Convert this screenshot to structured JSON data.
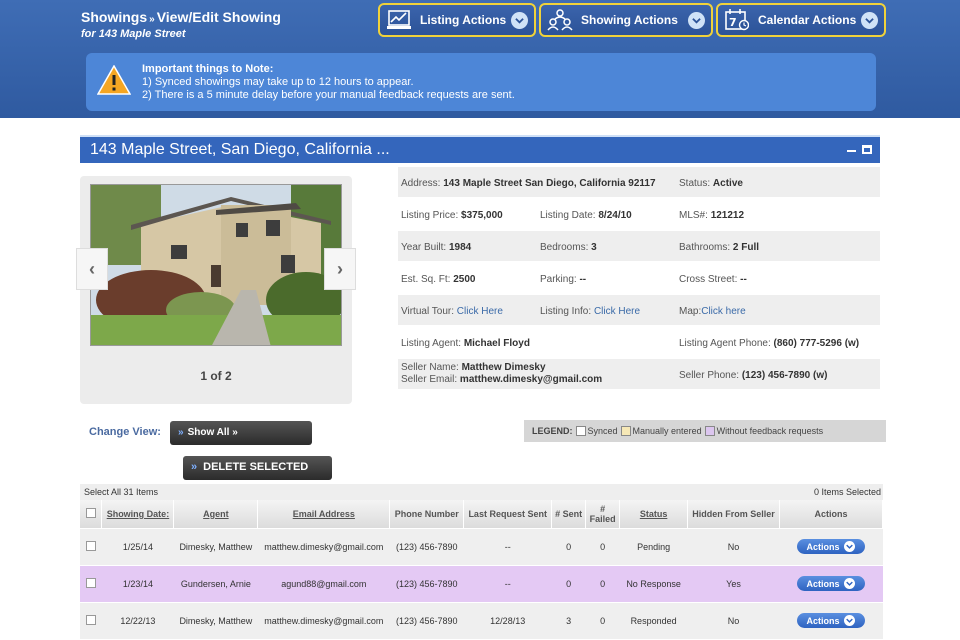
{
  "header": {
    "breadcrumb_root": "Showings",
    "breadcrumb_sep": "»",
    "breadcrumb_current": "View/Edit Showing",
    "subtitle": "for 143 Maple Street",
    "buttons": [
      {
        "label": "Listing Actions",
        "icon": "laptop-chart-icon"
      },
      {
        "label": "Showing Actions",
        "icon": "people-icon"
      },
      {
        "label": "Calendar Actions",
        "icon": "calendar-icon"
      }
    ]
  },
  "notice": {
    "title": "Important things to Note:",
    "line1": "1) Synced showings may take up to 12 hours to appear.",
    "line2": "2) There is a 5 minute delay before your manual feedback requests are sent."
  },
  "listing": {
    "title": "143 Maple Street, San Diego, California ...",
    "photo_counter": "1 of 2",
    "rows": [
      [
        {
          "k": "Address:",
          "v": "143 Maple Street San Diego, California 92117"
        },
        null,
        {
          "k": "Status:",
          "v": "Active"
        }
      ],
      [
        {
          "k": "Listing Price:",
          "v": "$375,000"
        },
        {
          "k": "Listing Date:",
          "v": "8/24/10"
        },
        {
          "k": "MLS#:",
          "v": "121212"
        }
      ],
      [
        {
          "k": "Year Built:",
          "v": "1984"
        },
        {
          "k": "Bedrooms:",
          "v": "3"
        },
        {
          "k": "Bathrooms:",
          "v": "2 Full"
        }
      ],
      [
        {
          "k": "Est. Sq. Ft:",
          "v": "2500"
        },
        {
          "k": "Parking:",
          "v": "--"
        },
        {
          "k": "Cross Street:",
          "v": "--"
        }
      ],
      [
        {
          "k": "Virtual Tour:",
          "link": "Click Here"
        },
        {
          "k": "Listing Info:",
          "link": "Click Here"
        },
        {
          "k": "Map:",
          "link": "Click here"
        }
      ],
      [
        {
          "k": "Listing Agent:",
          "v": "Michael Floyd"
        },
        null,
        {
          "k": "Listing Agent Phone:",
          "v": "(860) 777-5296 (w)"
        }
      ]
    ],
    "seller": {
      "name_label": "Seller Name:",
      "name": "Matthew Dimesky",
      "email_label": "Seller Email:",
      "email": "matthew.dimesky@gmail.com",
      "phone_label": "Seller Phone:",
      "phone": "(123) 456-7890 (w)"
    }
  },
  "view": {
    "change_view_label": "Change View:",
    "show_all_label": "Show All",
    "delete_label": "DELETE SELECTED",
    "legend_label": "LEGEND:",
    "legend_items": [
      "Synced",
      "Manually entered",
      "Without feedback requests"
    ]
  },
  "table": {
    "select_all": "Select All 31 Items",
    "selected_count": "0 Items Selected",
    "columns": [
      "Showing Date:",
      "Agent",
      "Email Address",
      "Phone Number",
      "Last Request Sent",
      "# Sent",
      "# Failed",
      "Status",
      "Hidden From Seller",
      "Actions"
    ],
    "rows": [
      {
        "date": "1/25/14",
        "agent": "Dimesky, Matthew",
        "email": "matthew.dimesky@gmail.com",
        "phone": "(123) 456-7890",
        "last": "--",
        "sent": "0",
        "failed": "0",
        "status": "Pending",
        "hidden": "No",
        "action": "Actions"
      },
      {
        "date": "1/23/14",
        "agent": "Gundersen, Arnie",
        "email": "agund88@gmail.com",
        "phone": "(123) 456-7890",
        "last": "--",
        "sent": "0",
        "failed": "0",
        "status": "No Response",
        "hidden": "Yes",
        "action": "Actions"
      },
      {
        "date": "12/22/13",
        "agent": "Dimesky, Matthew",
        "email": "matthew.dimesky@gmail.com",
        "phone": "(123) 456-7890",
        "last": "12/28/13",
        "sent": "3",
        "failed": "0",
        "status": "Responded",
        "hidden": "No",
        "action": "Actions"
      }
    ]
  }
}
